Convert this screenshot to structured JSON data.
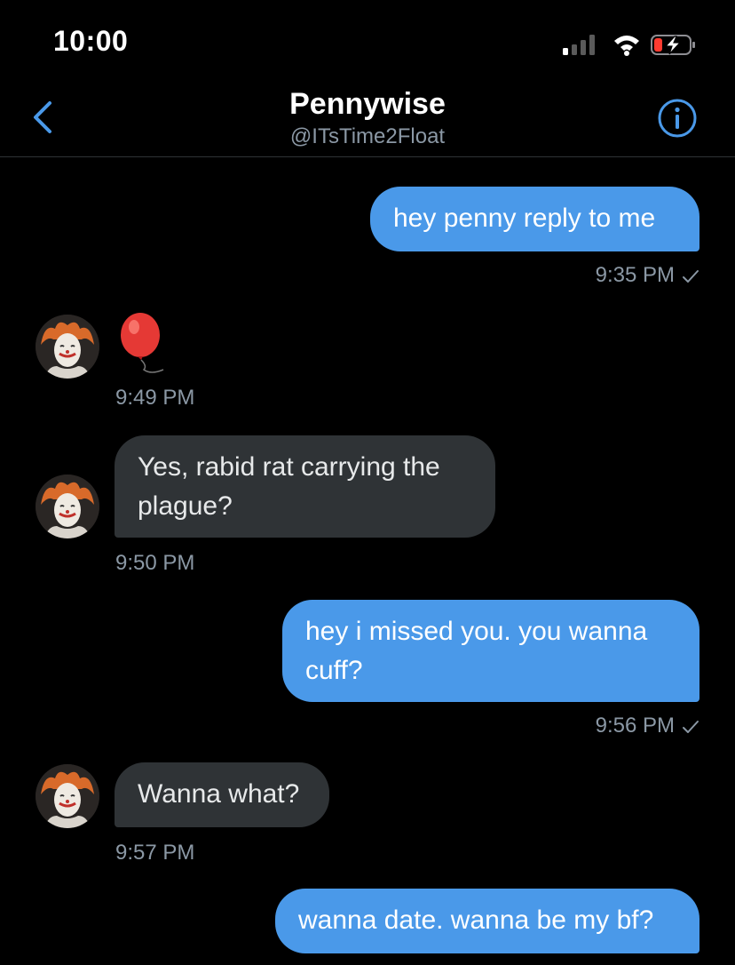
{
  "status_bar": {
    "time": "10:00",
    "icons": [
      "signal-icon",
      "wifi-icon",
      "battery-charging-icon"
    ],
    "battery_color": "#ff3b30"
  },
  "header": {
    "name": "Pennywise",
    "handle": "@ITsTime2Float",
    "back_icon": "chevron-left-icon",
    "info_icon": "info-icon",
    "accent_color": "#4a99e9"
  },
  "messages": [
    {
      "direction": "sent",
      "text": "hey penny reply to me",
      "time": "9:35 PM",
      "read_check": true
    },
    {
      "direction": "received",
      "text": "🎈",
      "kind": "emoji",
      "emoji_name": "balloon-icon",
      "time": "9:49 PM"
    },
    {
      "direction": "received",
      "text": "Yes, rabid rat carrying the plague?",
      "time": "9:50 PM"
    },
    {
      "direction": "sent",
      "text": "hey i missed you. you wanna cuff?",
      "time": "9:56 PM",
      "read_check": true
    },
    {
      "direction": "received",
      "text": "Wanna what?",
      "time": "9:57 PM"
    },
    {
      "direction": "sent",
      "text": "wanna date. wanna be my bf?"
    }
  ]
}
